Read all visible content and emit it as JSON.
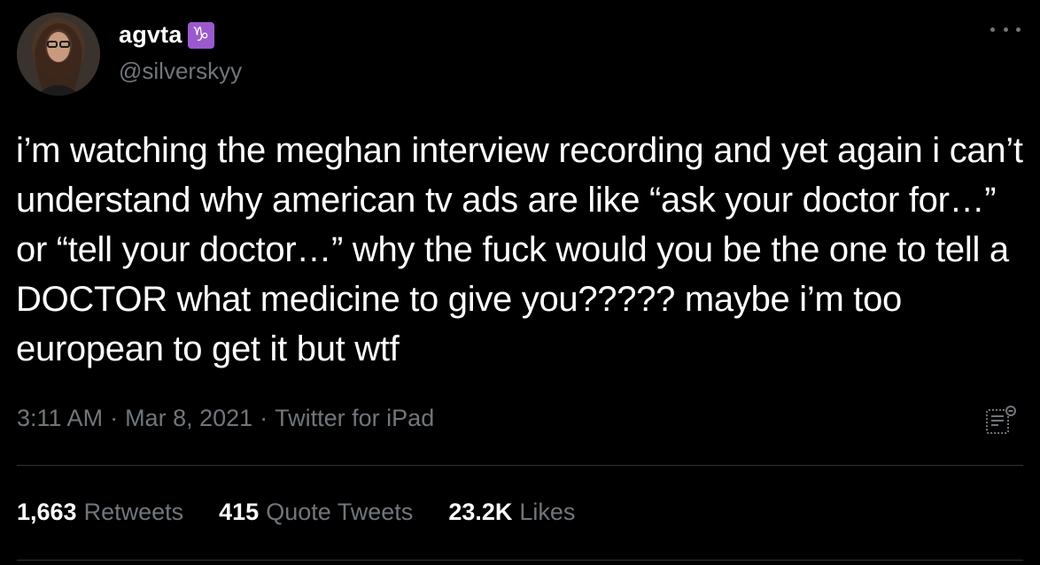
{
  "user": {
    "display_name": "agvta",
    "zodiac_badge": "♑",
    "handle": "@silverskyy"
  },
  "tweet": {
    "text": "i’m watching the meghan interview recording and yet again i can’t understand why american tv ads are like “ask your doctor for…” or “tell your doctor…” why the fuck would you be the one to tell a DOCTOR what medicine to give you????? maybe i’m too european to get it but wtf",
    "time": "3:11 AM",
    "separator": "·",
    "date": "Mar 8, 2021",
    "source": "Twitter for iPad"
  },
  "stats": {
    "retweets_count": "1,663",
    "retweets_label": "Retweets",
    "quotes_count": "415",
    "quotes_label": "Quote Tweets",
    "likes_count": "23.2K",
    "likes_label": "Likes"
  },
  "icons": {
    "more": "more-horizontal-icon",
    "analytics": "analytics-icon"
  },
  "colors": {
    "background": "#000000",
    "text": "#ffffff",
    "secondary": "#71767b",
    "badge": "#9b59d0"
  }
}
